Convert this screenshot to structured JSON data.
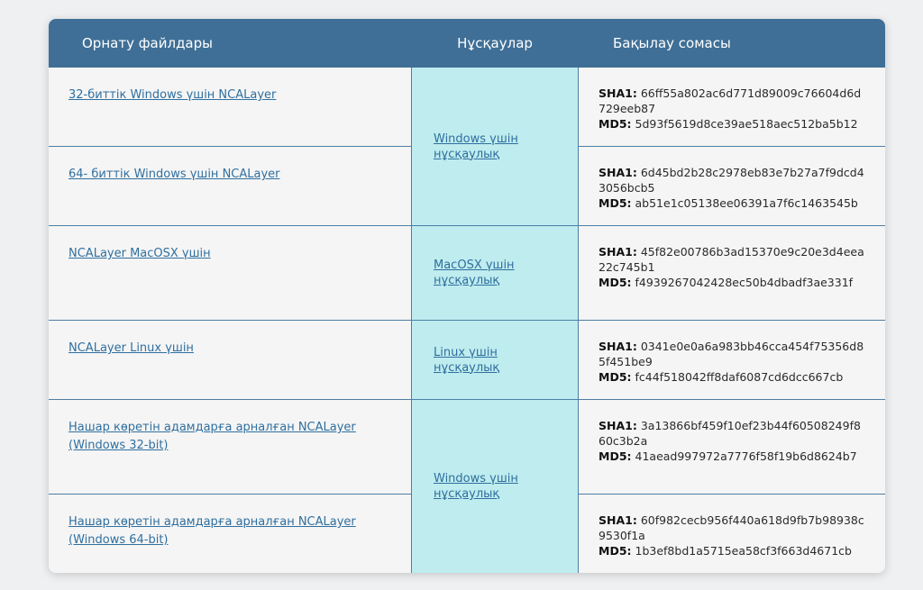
{
  "header": {
    "col1": "Орнату файлдары",
    "col2": "Нұсқаулар",
    "col3": "Бақылау сомасы"
  },
  "files": [
    {
      "label": "32-биттік Windows үшін NCALayer",
      "sha1": "66ff55a802ac6d771d89009c76604d6d729eeb87",
      "md5": "5d93f5619d8ce39ae518aec512ba5b12"
    },
    {
      "label": "64- биттік Windows үшін NCALayer",
      "sha1": "6d45bd2b28c2978eb83e7b27a7f9dcd43056bcb5",
      "md5": "ab51e1c05138ee06391a7f6c1463545b"
    },
    {
      "label": "NCALayer MacOSX үшін",
      "sha1": "45f82e00786b3ad15370e9c20e3d4eea22c745b1",
      "md5": "f4939267042428ec50b4dbadf3ae331f"
    },
    {
      "label": "NCALayer Linux үшін",
      "sha1": "0341e0e0a6a983bb46cca454f75356d85f451be9",
      "md5": "fc44f518042ff8daf6087cd6dcc667cb"
    },
    {
      "label": "Нашар көретін адамдарға арналған NCALayer (Windows 32-bit)",
      "sha1": "3a13866bf459f10ef23b44f60508249f860c3b2a",
      "md5": "41aead997972a7776f58f19b6d8624b7"
    },
    {
      "label": "Нашар көретін адамдарға арналған NCALayer (Windows 64-bit)",
      "sha1": "60f982cecb956f440a618d9fb7b98938c9530f1a",
      "md5": "1b3ef8bd1a5715ea58cf3f663d4671cb"
    }
  ],
  "guides": [
    "Windows үшін нұсқаулық",
    "MacOSX үшін нұсқаулық",
    "Linux үшін нұсқаулық",
    "Windows үшін нұсқаулық"
  ],
  "labels": {
    "sha1": "SHA1:",
    "md5": "MD5:"
  }
}
